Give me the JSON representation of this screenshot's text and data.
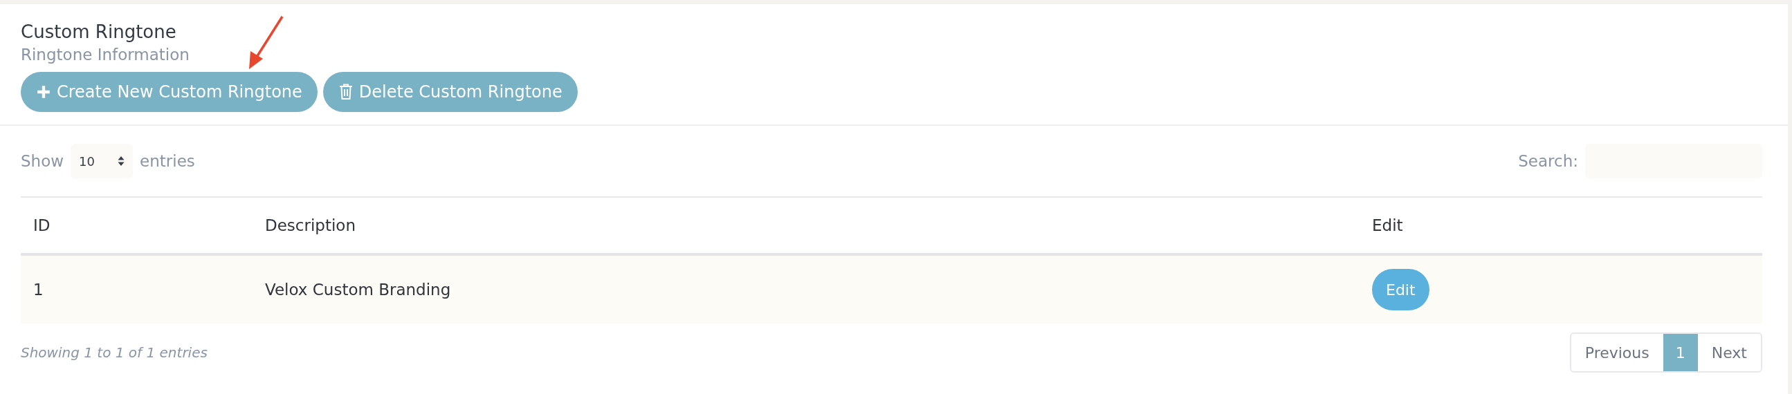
{
  "header": {
    "title": "Custom Ringtone",
    "subtitle": "Ringtone Information"
  },
  "actions": [
    {
      "label": "Create New Custom Ringtone",
      "kind": "plus"
    },
    {
      "label": "Delete Custom Ringtone",
      "kind": "trash"
    }
  ],
  "length": {
    "before": "Show",
    "value": "10",
    "after": "entries"
  },
  "search": {
    "label": "Search:"
  },
  "table": {
    "columns": [
      "ID",
      "Description",
      "Edit"
    ],
    "rows": [
      {
        "id": "1",
        "description": "Velox Custom Branding",
        "edit": "Edit"
      }
    ]
  },
  "info": "Showing 1 to 1 of 1 entries",
  "pagination": [
    {
      "label": "Previous",
      "selected": false
    },
    {
      "label": "1",
      "selected": true
    },
    {
      "label": "Next",
      "selected": false
    }
  ]
}
